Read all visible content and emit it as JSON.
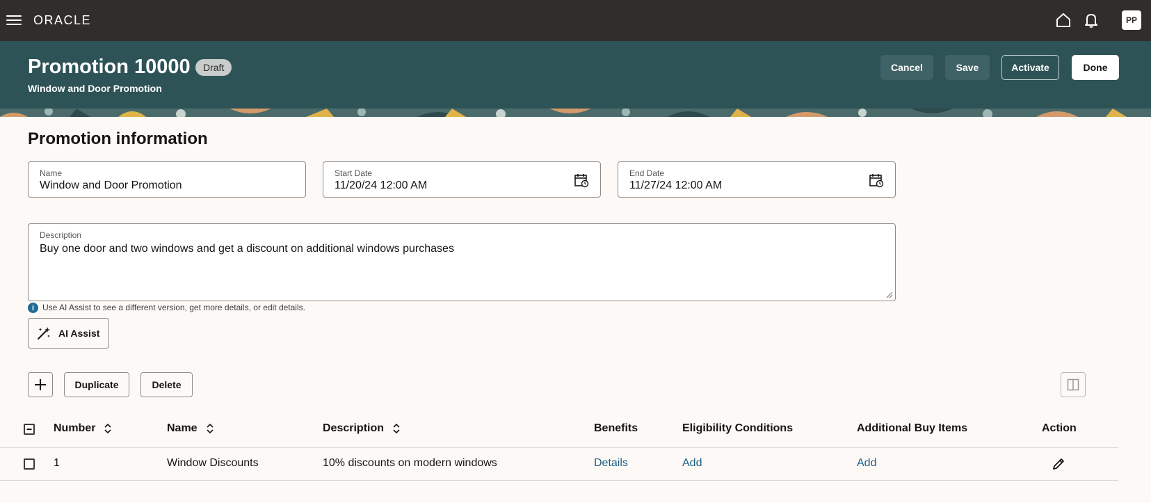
{
  "topbar": {
    "logo": "ORACLE",
    "avatar_initials": "PP",
    "icons": [
      "hamburger-menu-icon",
      "home-icon",
      "bell-icon"
    ]
  },
  "header": {
    "title": "Promotion 10000",
    "status": "Draft",
    "subtitle": "Window and Door Promotion",
    "buttons": {
      "cancel": "Cancel",
      "save": "Save",
      "activate": "Activate",
      "done": "Done"
    }
  },
  "section": {
    "title": "Promotion information"
  },
  "form": {
    "name": {
      "label": "Name",
      "value": "Window and Door Promotion"
    },
    "start_date": {
      "label": "Start Date",
      "value": "11/20/24 12:00 AM"
    },
    "end_date": {
      "label": "End Date",
      "value": "11/27/24 12:00 AM"
    },
    "description": {
      "label": "Description",
      "value": "Buy one door and two windows and get a discount on additional windows purchases"
    },
    "helper_text": "Use AI Assist to see a different version, get more details, or edit details.",
    "ai_assist_label": "AI Assist"
  },
  "toolbar": {
    "duplicate": "Duplicate",
    "delete": "Delete"
  },
  "table": {
    "headers": {
      "number": "Number",
      "name": "Name",
      "description": "Description",
      "benefits": "Benefits",
      "eligibility": "Eligibility Conditions",
      "additional": "Additional Buy Items",
      "action": "Action"
    },
    "rows": [
      {
        "number": "1",
        "name": "Window Discounts",
        "description": "10% discounts on modern windows",
        "benefits": "Details",
        "eligibility": "Add",
        "additional": "Add"
      }
    ]
  },
  "colors": {
    "topbar": "#312d2a",
    "header": "#2e5357",
    "link": "#1a5f83",
    "background": "#fcf9f7"
  }
}
